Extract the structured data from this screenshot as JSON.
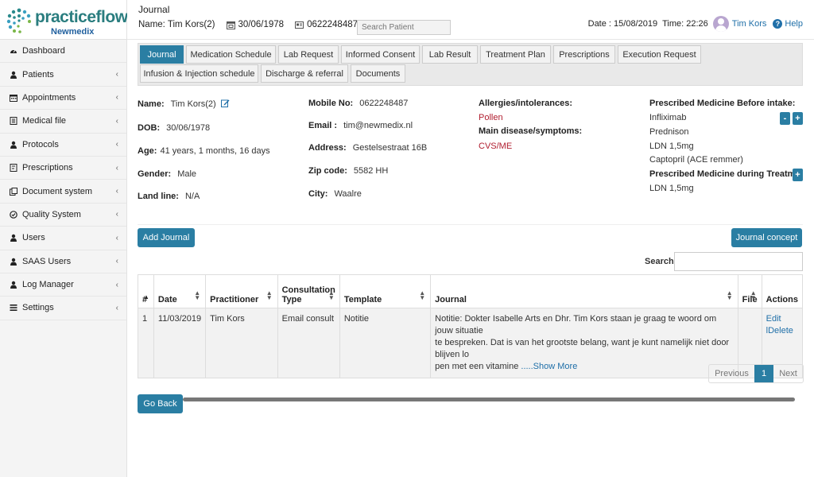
{
  "brand": {
    "name": "practiceflow",
    "sub": "Newmedix"
  },
  "sidebar": {
    "items": [
      {
        "label": "Dashboard",
        "icon": "dashboard-icon",
        "has_chevron": false
      },
      {
        "label": "Patients",
        "icon": "user-icon",
        "has_chevron": true
      },
      {
        "label": "Appointments",
        "icon": "calendar-icon",
        "has_chevron": true
      },
      {
        "label": "Medical file",
        "icon": "file-icon",
        "has_chevron": true
      },
      {
        "label": "Protocols",
        "icon": "user-icon",
        "has_chevron": true
      },
      {
        "label": "Prescriptions",
        "icon": "prescription-icon",
        "has_chevron": true
      },
      {
        "label": "Document system",
        "icon": "documents-icon",
        "has_chevron": true
      },
      {
        "label": "Quality System",
        "icon": "check-circle-icon",
        "has_chevron": true
      },
      {
        "label": "Users",
        "icon": "user-icon",
        "has_chevron": true
      },
      {
        "label": "SAAS Users",
        "icon": "user-icon",
        "has_chevron": true
      },
      {
        "label": "Log Manager",
        "icon": "user-icon",
        "has_chevron": true
      },
      {
        "label": "Settings",
        "icon": "settings-icon",
        "has_chevron": true
      }
    ]
  },
  "header": {
    "title": "Journal",
    "patient_name": "Name: Tim Kors(2)",
    "dob": "30/06/1978",
    "phone": "0622248487",
    "search_placeholder": "Search Patient",
    "date": "Date : 15/08/2019",
    "time": "Time: 22:26",
    "user": "Tim Kors",
    "help": "Help"
  },
  "tabs": [
    "Journal",
    "Medication Schedule",
    "Lab Request",
    "Informed Consent",
    "Lab Result",
    "Treatment Plan",
    "Prescriptions",
    "Execution Request",
    "Infusion & Injection schedule",
    "Discharge & referral",
    "Documents"
  ],
  "patient": {
    "name_label": "Name:",
    "name": "Tim Kors(2)",
    "dob_label": "DOB:",
    "dob": "30/06/1978",
    "age_label": "Age:",
    "age": "41 years, 1 months, 16 days",
    "gender_label": "Gender:",
    "gender": "Male",
    "landline_label": "Land line:",
    "landline": "N/A",
    "mobile_label": "Mobile No:",
    "mobile": "0622248487",
    "email_label": "Email :",
    "email": "tim@newmedix.nl",
    "address_label": "Address:",
    "address": "Gestelsestraat 16B",
    "zip_label": "Zip code:",
    "zip": "5582 HH",
    "city_label": "City:",
    "city": "Waalre",
    "allergies_label": "Allergies/intolerances:",
    "allergies": "Pollen",
    "disease_label": "Main disease/symptoms:",
    "disease": "CVS/ME",
    "before_label": "Prescribed Medicine Before intake:",
    "before_meds": [
      "Infliximab",
      "Prednison",
      "LDN 1,5mg",
      "Captopril (ACE remmer)"
    ],
    "during_label": "Prescribed Medicine during Treatmen",
    "during_meds": [
      "LDN 1,5mg"
    ]
  },
  "actions": {
    "add_journal": "Add Journal",
    "journal_concept": "Journal concept",
    "search_label": "Search:",
    "go_back": "Go Back"
  },
  "table": {
    "columns": [
      "#",
      "Date",
      "Practitioner",
      "Consultation Type",
      "Template",
      "Journal",
      "File",
      "Actions"
    ],
    "rows": [
      {
        "num": "1",
        "date": "11/03/2019",
        "practitioner": "Tim Kors",
        "consultation_type": "Email consult",
        "template": "Notitie",
        "journal_l1": "Notitie: Dokter Isabelle Arts en Dhr. Tim Kors staan je graag te woord om jouw situatie",
        "journal_l2": "te bespreken. Dat is van het grootste belang, want je kunt namelijk niet door blijven lo",
        "journal_l3": "pen met een vitamine ",
        "show_more": ".....Show More",
        "file": "",
        "edit": "Edit",
        "delete": "lDelete"
      }
    ]
  },
  "pager": {
    "prev": "Previous",
    "current": "1",
    "next": "Next"
  },
  "colors": {
    "accent": "#2a7ea3",
    "danger_text": "#b01c2e",
    "link": "#1f6fa8"
  }
}
